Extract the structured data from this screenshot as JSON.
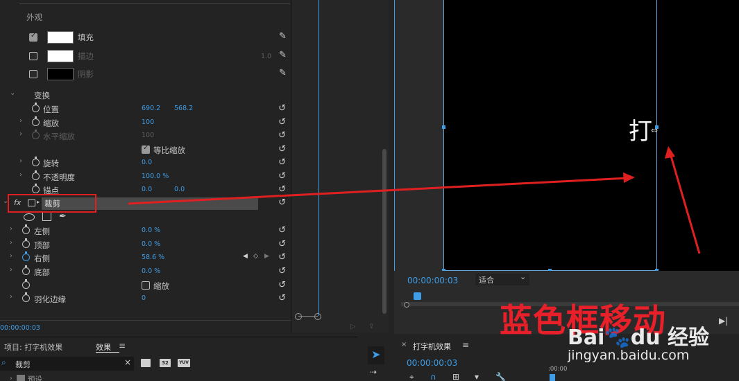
{
  "effect_controls": {
    "appearance_header": "外观",
    "appearance_rows": [
      {
        "label": "填充",
        "checked": true,
        "swatch": "#ffffff",
        "value": ""
      },
      {
        "label": "描边",
        "checked": false,
        "swatch": "#ffffff",
        "value": "1.0"
      },
      {
        "label": "阴影",
        "checked": false,
        "swatch": "#000000",
        "value": ""
      }
    ],
    "transform_header": "变换",
    "transform_rows": [
      {
        "label": "位置",
        "v1": "690.2",
        "v2": "568.2"
      },
      {
        "label": "缩放",
        "v1": "100",
        "v2": ""
      },
      {
        "label": "水平缩放",
        "v1": "100",
        "v2": ""
      },
      {
        "label": "等比缩放",
        "v1": "",
        "v2": ""
      },
      {
        "label": "旋转",
        "v1": "0.0",
        "v2": ""
      },
      {
        "label": "不透明度",
        "v1": "100.0 %",
        "v2": ""
      },
      {
        "label": "锚点",
        "v1": "0.0",
        "v2": "0.0"
      }
    ],
    "fx_label": "fx",
    "crop_effect_name": "裁剪",
    "crop_rows": [
      {
        "label": "左侧",
        "v1": "0.0 %"
      },
      {
        "label": "顶部",
        "v1": "0.0 %"
      },
      {
        "label": "右侧",
        "v1": "58.6 %"
      },
      {
        "label": "底部",
        "v1": "0.0 %"
      },
      {
        "label": "缩放",
        "v1": ""
      },
      {
        "label": "羽化边缘",
        "v1": "0"
      }
    ],
    "timecode": "00:00:00:03"
  },
  "program_monitor": {
    "text_on_video": "打",
    "timecode": "00:00:00:03",
    "fit_label": "适合",
    "fit_arrow": "⌄"
  },
  "project_panel": {
    "tab_project": "项目: 打字机效果",
    "tab_effects": "效果",
    "menu_icon": "≡",
    "search_value": "裁剪",
    "clear": "×",
    "preset_label": "预设",
    "icon_labels": [
      "32",
      "YUV"
    ]
  },
  "sequence_panel": {
    "close": "×",
    "title": "打字机效果",
    "menu_icon": "≡",
    "timecode": "00:00:00:03",
    "ruler_label": ":00:00"
  },
  "annotation": {
    "caption": "蓝色框移动"
  },
  "watermark": {
    "logo_text": "Bai🐾du 经验",
    "url": "jingyan.baidu.com"
  }
}
